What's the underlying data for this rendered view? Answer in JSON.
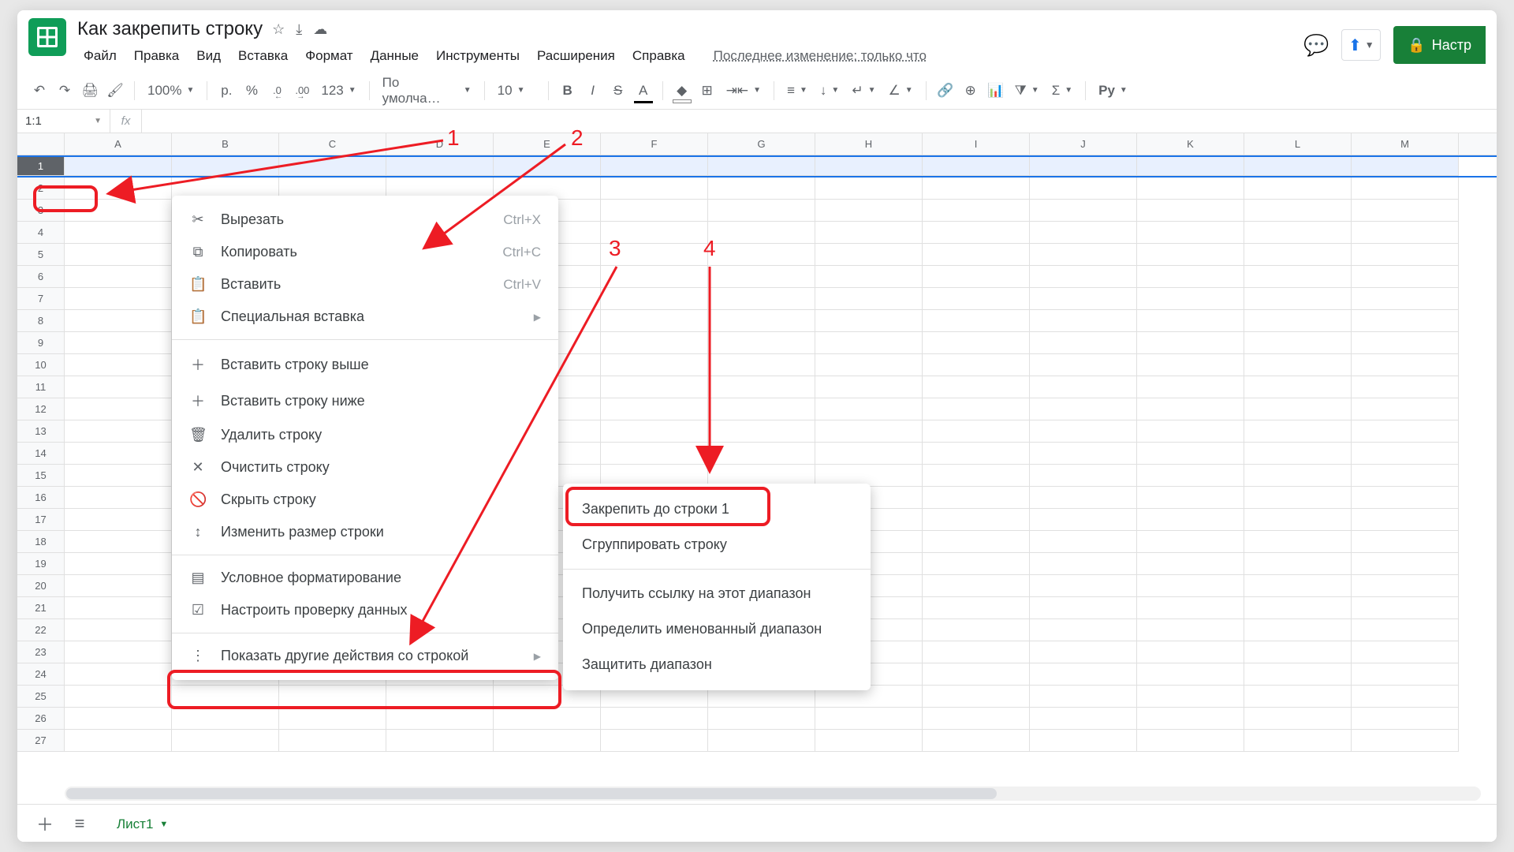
{
  "doc": {
    "title": "Как закрепить строку"
  },
  "menus": [
    "Файл",
    "Правка",
    "Вид",
    "Вставка",
    "Формат",
    "Данные",
    "Инструменты",
    "Расширения",
    "Справка"
  ],
  "last_edit": "Последнее изменение: только что",
  "share_btn": "Настр",
  "toolbar": {
    "zoom": "100%",
    "currency": "р.",
    "percent": "%",
    "dec_dec": ".0",
    "inc_dec": ".00",
    "numfmt": "123",
    "font": "По умолча…",
    "size": "10",
    "script": "Py"
  },
  "namebox": "1:1",
  "columns": [
    "A",
    "B",
    "C",
    "D",
    "E",
    "F",
    "G",
    "H",
    "I",
    "J",
    "K",
    "L",
    "M"
  ],
  "rows": 27,
  "ctx1": {
    "cut": {
      "label": "Вырезать",
      "sc": "Ctrl+X"
    },
    "copy": {
      "label": "Копировать",
      "sc": "Ctrl+C"
    },
    "paste": {
      "label": "Вставить",
      "sc": "Ctrl+V"
    },
    "paste_special": "Специальная вставка",
    "insert_above": "Вставить строку выше",
    "insert_below": "Вставить строку ниже",
    "delete_row": "Удалить строку",
    "clear_row": "Очистить строку",
    "hide_row": "Скрыть строку",
    "resize_row": "Изменить размер строки",
    "cond_fmt": "Условное форматирование",
    "data_valid": "Настроить проверку данных",
    "more_actions": "Показать другие действия со строкой"
  },
  "ctx2": {
    "freeze": "Закрепить до строки 1",
    "group": "Сгруппировать строку",
    "get_link": "Получить ссылку на этот диапазон",
    "named_range": "Определить именованный диапазон",
    "protect": "Защитить диапазон"
  },
  "annot": {
    "n1": "1",
    "n2": "2",
    "n3": "3",
    "n4": "4"
  },
  "sheet_tab": "Лист1"
}
